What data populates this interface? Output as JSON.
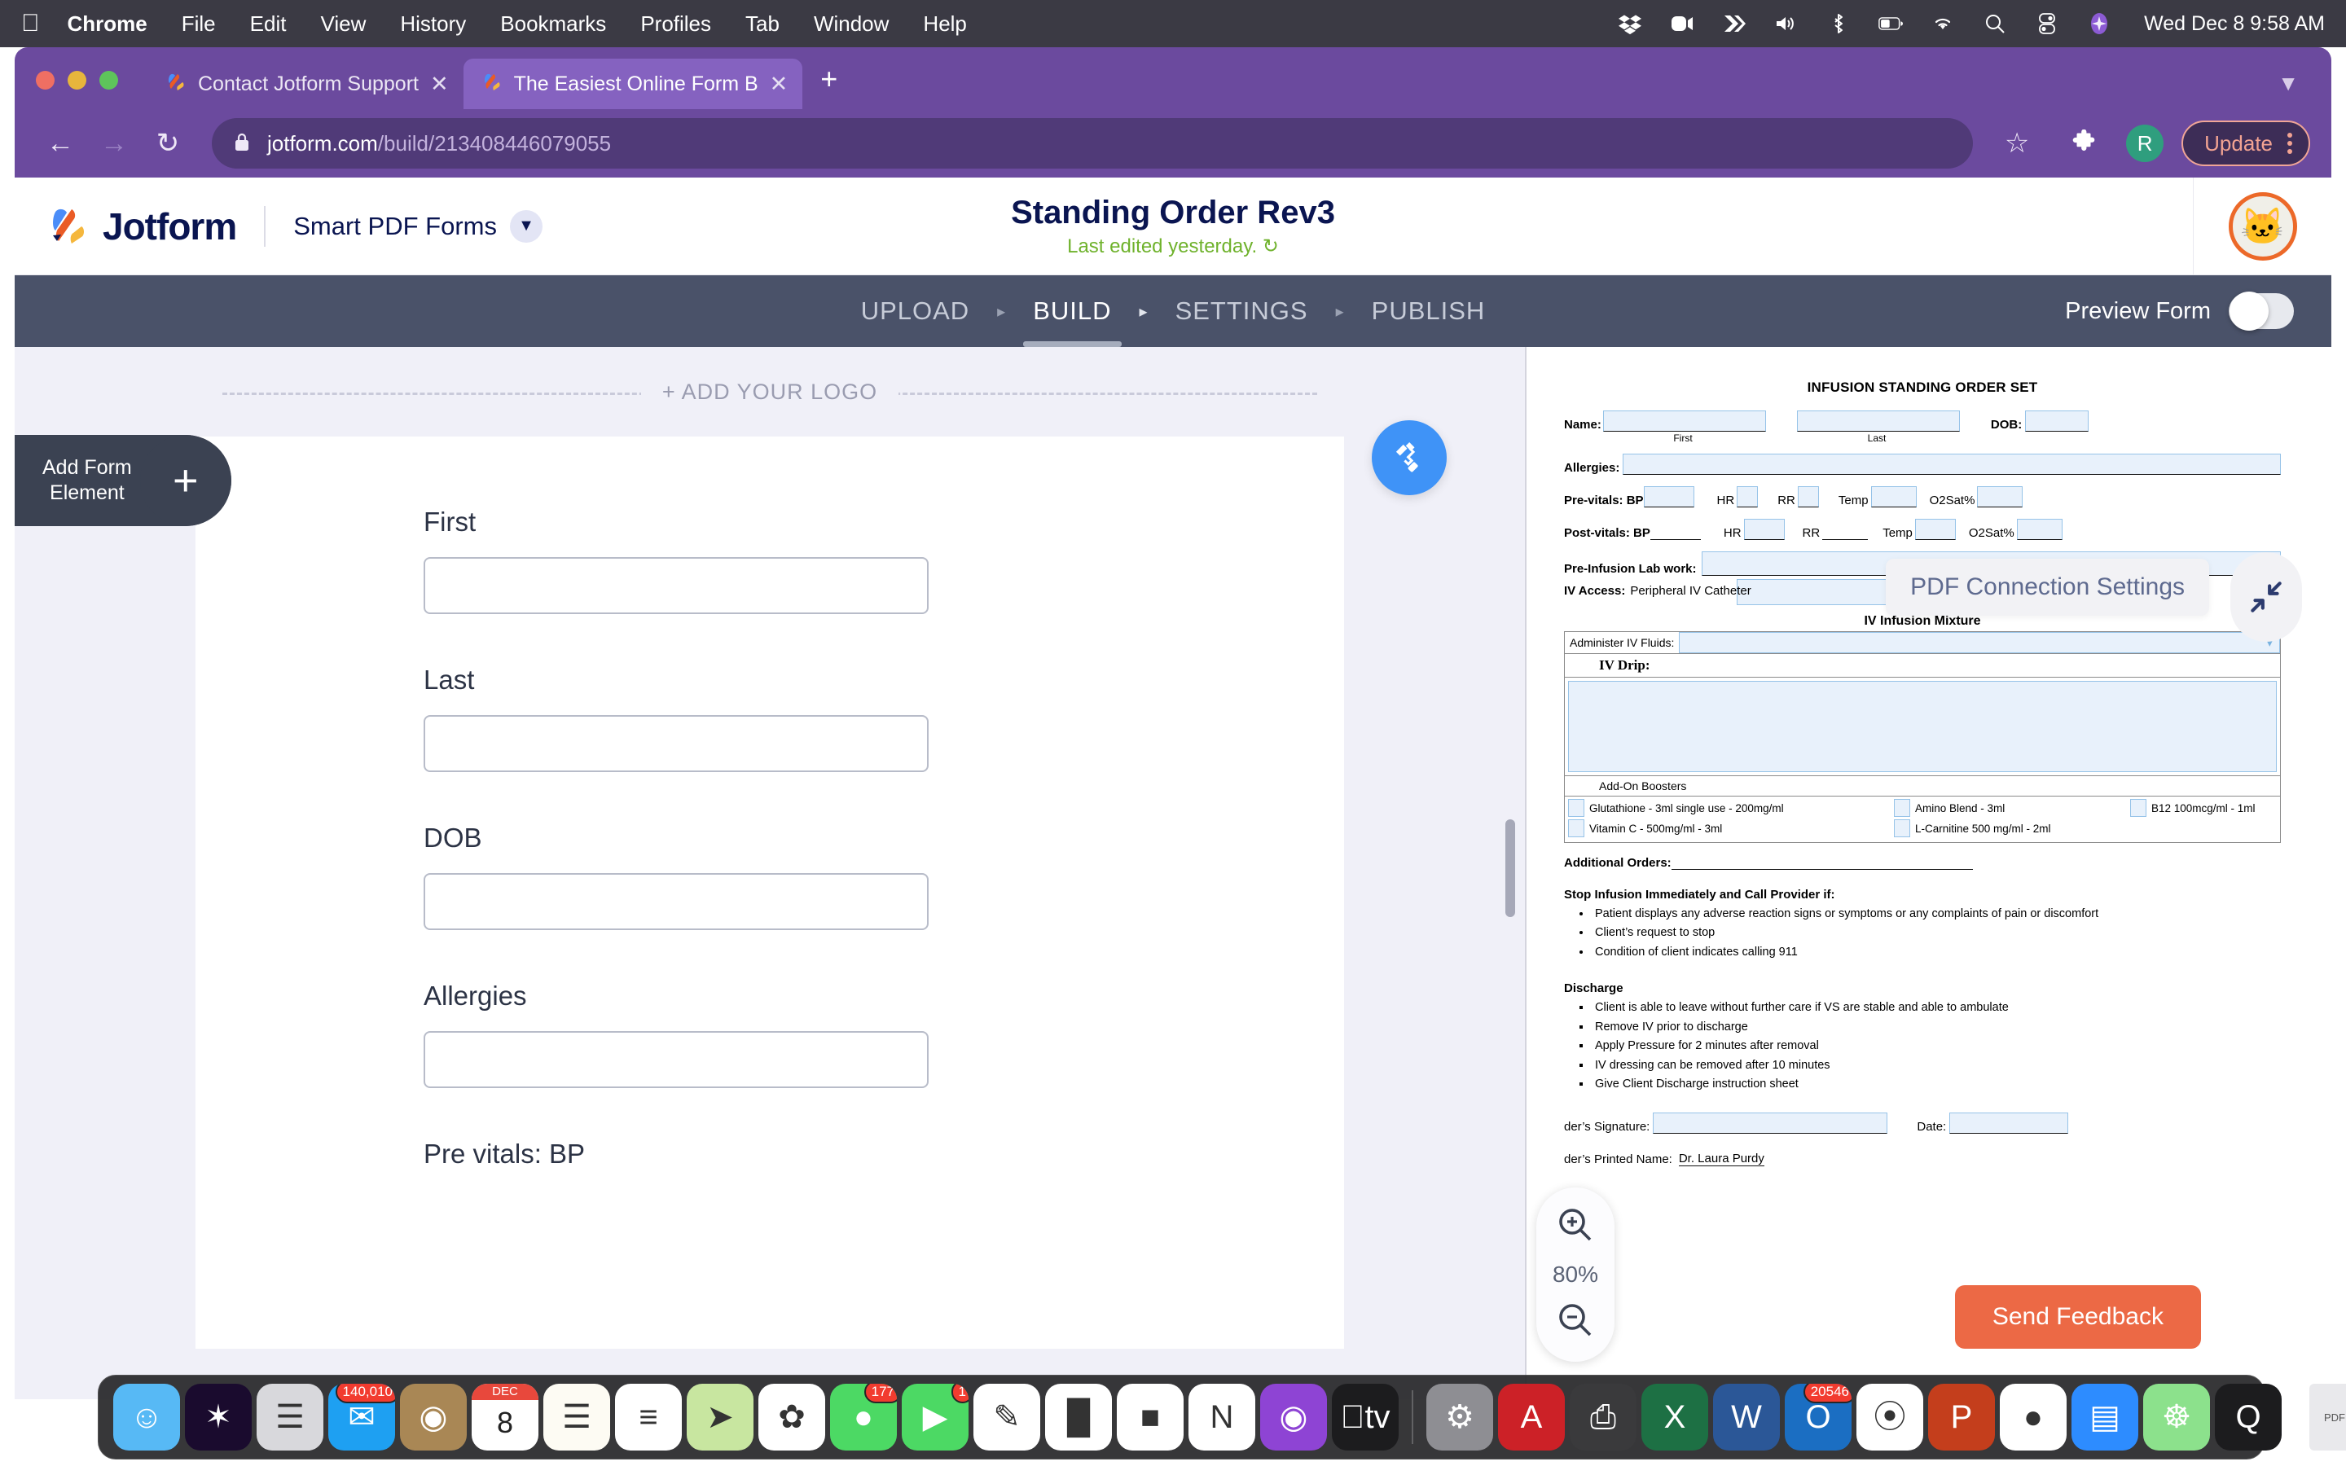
{
  "menubar": {
    "apple_icon": "apple-icon",
    "items": [
      {
        "label": "Chrome",
        "bold": true
      },
      {
        "label": "File",
        "bold": false
      },
      {
        "label": "Edit",
        "bold": false
      },
      {
        "label": "View",
        "bold": false
      },
      {
        "label": "History",
        "bold": false
      },
      {
        "label": "Bookmarks",
        "bold": false
      },
      {
        "label": "Profiles",
        "bold": false
      },
      {
        "label": "Tab",
        "bold": false
      },
      {
        "label": "Window",
        "bold": false
      },
      {
        "label": "Help",
        "bold": false
      }
    ],
    "status_icons": [
      "dropbox-icon",
      "screen-recorder-icon",
      "chevron-double-right-icon",
      "volume-icon",
      "bluetooth-icon",
      "battery-icon",
      "wifi-icon",
      "search-icon",
      "control-center-icon",
      "siri-icon"
    ],
    "clock": "Wed Dec 8  9:58 AM"
  },
  "browser": {
    "tabs": [
      {
        "title": "Contact Jotform Support",
        "active": false,
        "favicon": "jotform-favicon",
        "close": "✕"
      },
      {
        "title": "The Easiest Online Form Builde",
        "active": true,
        "favicon": "jotform-favicon",
        "close": "✕"
      }
    ],
    "new_tab_label": "+",
    "window_chevron": "chevron-down-icon",
    "back_icon": "back-arrow-icon",
    "forward_icon": "forward-arrow-icon",
    "reload_icon": "reload-icon",
    "lock_icon": "lock-icon",
    "url_host": "jotform.com",
    "url_path": "/build/213408446079055",
    "bookmark_icon": "star-icon",
    "extensions_icon": "puzzle-piece-icon",
    "profile_initial": "R",
    "update_label": "Update",
    "menu_icon": "kebab-menu-icon"
  },
  "app_header": {
    "logo_text": "Jotform",
    "product_selector": "Smart PDF Forms",
    "product_chevron": "chevron-down-icon",
    "form_title": "Standing Order Rev3",
    "last_edited": "Last edited yesterday.",
    "undo_icon": "undo-icon",
    "avatar": "cat-avatar"
  },
  "nav": {
    "tabs": [
      {
        "label": "UPLOAD",
        "active": false
      },
      {
        "label": "BUILD",
        "active": true
      },
      {
        "label": "SETTINGS",
        "active": false
      },
      {
        "label": "PUBLISH",
        "active": false
      }
    ],
    "arrow": "▸",
    "preview_label": "Preview Form",
    "preview_on": false
  },
  "builder": {
    "add_form_element_label_line1": "Add Form",
    "add_form_element_label_line2": "Element",
    "add_form_element_plus": "+",
    "logo_placeholder": "+ ADD YOUR LOGO",
    "designer_icon": "paint-roller-icon",
    "fields": [
      {
        "label": "First",
        "value": "",
        "placeholder": ""
      },
      {
        "label": "Last",
        "value": "",
        "placeholder": ""
      },
      {
        "label": "DOB",
        "value": "",
        "placeholder": ""
      },
      {
        "label": "Allergies",
        "value": "",
        "placeholder": ""
      },
      {
        "label": "Pre vitals: BP",
        "value": "",
        "placeholder": ""
      }
    ]
  },
  "pdf": {
    "connection_settings_label": "PDF Connection Settings",
    "collapse_icon": "collapse-diagonal-icon",
    "zoom_in_icon": "zoom-in-icon",
    "zoom_out_icon": "zoom-out-icon",
    "zoom_level": "80%",
    "feedback_label": "Send Feedback",
    "doc": {
      "title": "INFUSION STANDING ORDER SET",
      "name_label": "Name:",
      "dob_label": "DOB:",
      "first_caption": "First",
      "last_caption": "Last",
      "allergies_label": "Allergies:",
      "previtals_label": "Pre-vitals: BP",
      "postvitals_label": "Post-vitals: BP",
      "postvitals_bp_value": "BP",
      "hr_label": "HR",
      "rr_label": "RR",
      "temp_label": "Temp",
      "o2_label": "O2Sat%",
      "prelab_label": "Pre-Infusion Lab work:",
      "ivaccess_label": "IV Access:",
      "ivaccess_value": "Peripheral IV Catheter",
      "mixture_title": "IV Infusion Mixture",
      "administer_label": "Administer IV Fluids:",
      "administer_value": "",
      "administer_chevron": "chevron-down-icon",
      "ivdrip_label": "IV Drip:",
      "ivdrip_value": "",
      "boosters_header": "Add-On Boosters",
      "boosters_col1": [
        "Glutathione - 3ml single use - 200mg/ml",
        "Vitamin C - 500mg/ml - 3ml"
      ],
      "boosters_col2": [
        "Amino Blend - 3ml",
        "L-Carnitine 500 mg/ml - 2ml"
      ],
      "boosters_col3": [
        "B12 100mcg/ml - 1ml"
      ],
      "additional_orders_label": "Additional Orders:",
      "stop_heading": "Stop Infusion Immediately and Call Provider if:",
      "stop_items": [
        "Patient displays any adverse reaction signs or symptoms or any complaints of pain or discomfort",
        "Client’s request to stop",
        "Condition of client indicates calling 911"
      ],
      "discharge_heading": "Discharge",
      "discharge_items": [
        "Client is able to leave without further care if VS are stable and able to ambulate",
        "Remove IV prior to discharge",
        "Apply Pressure for 2 minutes after removal",
        "IV dressing can be removed after 10 minutes",
        "Give Client Discharge instruction sheet"
      ],
      "signature_label": "der’s Signature:",
      "date_label": "Date:",
      "printed_name_label": "der’s Printed Name:",
      "printed_name_value": "Dr. Laura Purdy"
    }
  },
  "dock": {
    "items": [
      {
        "name": "finder-icon",
        "glyph": "☺",
        "bg": "#57b9f5",
        "badge": "",
        "running": true
      },
      {
        "name": "siri-icon",
        "glyph": "✶",
        "bg": "#1a0b2e",
        "badge": "",
        "running": false
      },
      {
        "name": "launchpad-icon",
        "glyph": "☰",
        "bg": "#d8d8dc",
        "badge": "",
        "running": false
      },
      {
        "name": "mail-icon",
        "glyph": "✉",
        "bg": "#1ea0f2",
        "badge": "140,010",
        "running": true
      },
      {
        "name": "photobooth-icon",
        "glyph": "◉",
        "bg": "#a98755",
        "badge": "",
        "running": false
      },
      {
        "name": "calendar-icon",
        "glyph": "8",
        "bg": "#ffffff",
        "badge": "",
        "running": true,
        "sub": "DEC"
      },
      {
        "name": "notes-icon",
        "glyph": "☰",
        "bg": "#fdfbf3",
        "badge": "",
        "running": false
      },
      {
        "name": "reminders-icon",
        "glyph": "≡",
        "bg": "#ffffff",
        "badge": "",
        "running": true
      },
      {
        "name": "maps-icon",
        "glyph": "➤",
        "bg": "#c8e6a0",
        "badge": "",
        "running": true
      },
      {
        "name": "photos-icon",
        "glyph": "✿",
        "bg": "#ffffff",
        "badge": "",
        "running": false
      },
      {
        "name": "messages-icon",
        "glyph": "●",
        "bg": "#4cd964",
        "badge": "177",
        "running": false
      },
      {
        "name": "facetime-icon",
        "glyph": "▶",
        "bg": "#4cd964",
        "badge": "1",
        "running": false
      },
      {
        "name": "pages-icon",
        "glyph": "✎",
        "bg": "#ffffff",
        "badge": "",
        "running": false
      },
      {
        "name": "numbers-icon",
        "glyph": "█",
        "bg": "#ffffff",
        "badge": "",
        "running": false
      },
      {
        "name": "keynote-icon",
        "glyph": "■",
        "bg": "#ffffff",
        "badge": "",
        "running": false
      },
      {
        "name": "news-icon",
        "glyph": "N",
        "bg": "#ffffff",
        "badge": "",
        "running": false
      },
      {
        "name": "podcasts-icon",
        "glyph": "◉",
        "bg": "#8e44d4",
        "badge": "",
        "running": false
      },
      {
        "name": "appletv-icon",
        "glyph": "tv",
        "bg": "#1c1c1e",
        "badge": "",
        "running": false
      },
      {
        "name": "system-preferences-icon",
        "glyph": "⚙",
        "bg": "#8e8e93",
        "badge": "",
        "running": false
      },
      {
        "name": "acrobat-icon",
        "glyph": "A",
        "bg": "#cc2127",
        "badge": "",
        "running": false
      },
      {
        "name": "printer-icon",
        "glyph": "⎙",
        "bg": "#3a3a3c",
        "badge": "",
        "running": false
      },
      {
        "name": "excel-icon",
        "glyph": "X",
        "bg": "#1d7044",
        "badge": "",
        "running": true
      },
      {
        "name": "word-icon",
        "glyph": "W",
        "bg": "#2b5797",
        "badge": "",
        "running": true
      },
      {
        "name": "outlook-icon",
        "glyph": "O",
        "bg": "#1b6ec2",
        "badge": "20546",
        "running": true
      },
      {
        "name": "safari-icon",
        "glyph": "⦿",
        "bg": "#ffffff",
        "badge": "",
        "running": true
      },
      {
        "name": "powerpoint-icon",
        "glyph": "P",
        "bg": "#c43e1c",
        "badge": "",
        "running": true
      },
      {
        "name": "chrome-icon",
        "glyph": "●",
        "bg": "#ffffff",
        "badge": "",
        "running": true
      },
      {
        "name": "zoom-icon",
        "glyph": "▤",
        "bg": "#2d8cff",
        "badge": "",
        "running": true
      },
      {
        "name": "mindnode-icon",
        "glyph": "☸",
        "bg": "#8ce18c",
        "badge": "",
        "running": true
      },
      {
        "name": "quicktime-icon",
        "glyph": "Q",
        "bg": "#1c1c1e",
        "badge": "",
        "running": true
      }
    ],
    "minimized": [
      {
        "name": "minimized-pdf-window",
        "glyph": "PDF"
      },
      {
        "name": "minimized-browser-window",
        "glyph": ""
      },
      {
        "name": "minimized-doc-window",
        "glyph": ""
      },
      {
        "name": "minimized-mail-window",
        "glyph": ""
      },
      {
        "name": "minimized-sheet-window",
        "glyph": ""
      }
    ],
    "trash": {
      "name": "trash-icon",
      "glyph": "🗑"
    }
  }
}
